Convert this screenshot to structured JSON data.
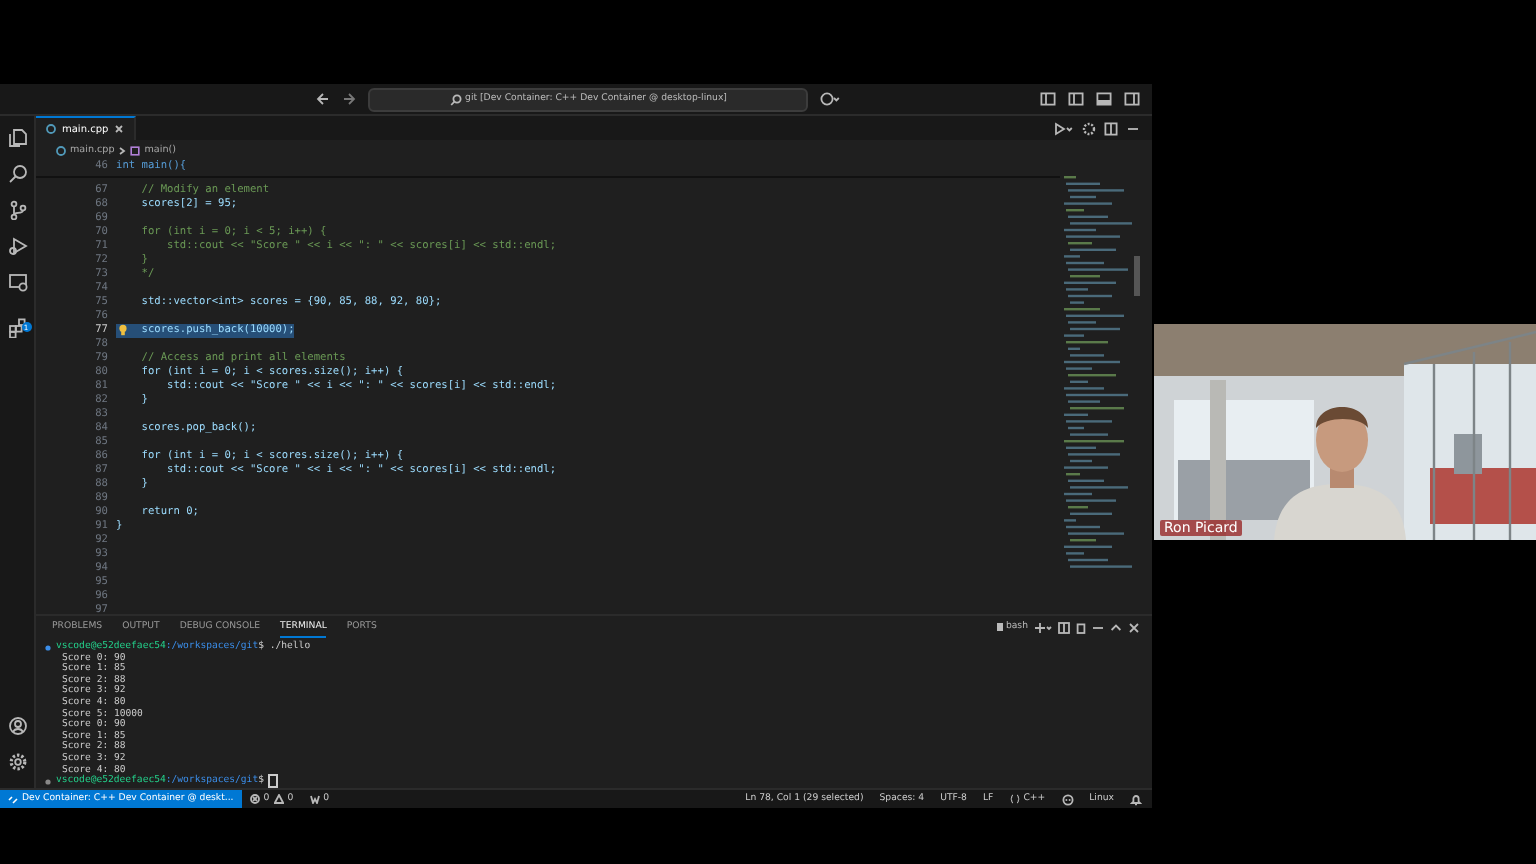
{
  "title_bar": {
    "command_center": "git [Dev Container: C++ Dev Container @ desktop-linux]"
  },
  "activity_bar": {
    "extensions_badge": "1"
  },
  "editor": {
    "tabs": [
      {
        "label": "main.cpp",
        "selected": true
      }
    ],
    "breadcrumbs": [
      "main.cpp",
      "main()"
    ],
    "sticky_line": {
      "number": "46",
      "text": "int main(){"
    },
    "lines": [
      {
        "number": "67",
        "kind": "comment",
        "text": "    // Modify an element",
        "selected": false,
        "lightbulb": false
      },
      {
        "number": "68",
        "kind": "code",
        "text": "    scores[2] = 95;",
        "selected": false,
        "lightbulb": false
      },
      {
        "number": "69",
        "selected": false,
        "lightbulb": false
      },
      {
        "number": "70",
        "kind": "comment",
        "text": "    for (int i = 0; i < 5; i++) {",
        "selected": false,
        "lightbulb": false
      },
      {
        "number": "71",
        "kind": "comment",
        "text": "        std::cout << \"Score \" << i << \": \" << scores[i] << std::endl;",
        "selected": false,
        "lightbulb": false
      },
      {
        "number": "72",
        "kind": "comment",
        "text": "    }",
        "selected": false,
        "lightbulb": false
      },
      {
        "number": "73",
        "kind": "comment",
        "text": "    */",
        "selected": false,
        "lightbulb": false
      },
      {
        "number": "74",
        "selected": false,
        "lightbulb": false
      },
      {
        "number": "75",
        "kind": "code",
        "text": "    std::vector<int> scores = {90, 85, 88, 92, 80};",
        "selected": false,
        "lightbulb": false
      },
      {
        "number": "76",
        "selected": false,
        "lightbulb": false
      },
      {
        "number": "77",
        "kind": "code",
        "text": "    scores.push_back(10000);",
        "selected": true,
        "lightbulb": true
      },
      {
        "number": "78",
        "selected": false,
        "lightbulb": false
      },
      {
        "number": "79",
        "kind": "comment",
        "text": "    // Access and print all elements",
        "selected": false,
        "lightbulb": false
      },
      {
        "number": "80",
        "kind": "code",
        "text": "    for (int i = 0; i < scores.size(); i++) {",
        "selected": false,
        "lightbulb": false
      },
      {
        "number": "81",
        "kind": "code",
        "text": "        std::cout << \"Score \" << i << \": \" << scores[i] << std::endl;",
        "selected": false,
        "lightbulb": false
      },
      {
        "number": "82",
        "kind": "code",
        "text": "    }",
        "selected": false,
        "lightbulb": false
      },
      {
        "number": "83",
        "selected": false,
        "lightbulb": false
      },
      {
        "number": "84",
        "kind": "code",
        "text": "    scores.pop_back();",
        "selected": false,
        "lightbulb": false
      },
      {
        "number": "85",
        "selected": false,
        "lightbulb": false
      },
      {
        "number": "86",
        "kind": "code",
        "text": "    for (int i = 0; i < scores.size(); i++) {",
        "selected": false,
        "lightbulb": false
      },
      {
        "number": "87",
        "kind": "code",
        "text": "        std::cout << \"Score \" << i << \": \" << scores[i] << std::endl;",
        "selected": false,
        "lightbulb": false
      },
      {
        "number": "88",
        "kind": "code",
        "text": "    }",
        "selected": false,
        "lightbulb": false
      },
      {
        "number": "89",
        "selected": false,
        "lightbulb": false
      },
      {
        "number": "90",
        "kind": "code",
        "text": "    return 0;",
        "selected": false,
        "lightbulb": false
      },
      {
        "number": "91",
        "kind": "code",
        "text": "}",
        "selected": false,
        "lightbulb": false
      },
      {
        "number": "92",
        "selected": false,
        "lightbulb": false
      },
      {
        "number": "93",
        "selected": false,
        "lightbulb": false
      },
      {
        "number": "94",
        "selected": false,
        "lightbulb": false
      },
      {
        "number": "95",
        "selected": false,
        "lightbulb": false
      },
      {
        "number": "96",
        "selected": false,
        "lightbulb": false
      },
      {
        "number": "97",
        "selected": false,
        "lightbulb": false
      }
    ]
  },
  "panel": {
    "tabs": [
      {
        "label": "PROBLEMS",
        "selected": false
      },
      {
        "label": "OUTPUT",
        "selected": false
      },
      {
        "label": "DEBUG CONSOLE",
        "selected": false
      },
      {
        "label": "TERMINAL",
        "selected": true
      },
      {
        "label": "PORTS",
        "selected": false
      }
    ],
    "terminal_name": "bash",
    "terminal_lines": [
      {
        "kind": "prompt",
        "user": "vscode@e52deefaec54",
        "path": ":/workspaces/git",
        "symbol": "$",
        "command": "./hello"
      },
      {
        "kind": "output",
        "text": "Score 0: 90"
      },
      {
        "kind": "output",
        "text": "Score 1: 85"
      },
      {
        "kind": "output",
        "text": "Score 2: 88"
      },
      {
        "kind": "output",
        "text": "Score 3: 92"
      },
      {
        "kind": "output",
        "text": "Score 4: 80"
      },
      {
        "kind": "output",
        "text": "Score 5: 10000"
      },
      {
        "kind": "output",
        "text": "Score 0: 90"
      },
      {
        "kind": "output",
        "text": "Score 1: 85"
      },
      {
        "kind": "output",
        "text": "Score 2: 88"
      },
      {
        "kind": "output",
        "text": "Score 3: 92"
      },
      {
        "kind": "output",
        "text": "Score 4: 80"
      },
      {
        "kind": "prompt",
        "user": "vscode@e52deefaec54",
        "path": ":/workspaces/git",
        "symbol": "$"
      }
    ]
  },
  "status_bar": {
    "remote": "Dev Container: C++ Dev Container @ deskt...",
    "errors": "0",
    "warnings": "0",
    "ports": "0",
    "right": [
      {
        "kind": "text",
        "text": "Ln 78, Col 1 (29 selected)"
      },
      {
        "kind": "text",
        "text": "Spaces: 4"
      },
      {
        "kind": "text",
        "text": "UTF-8"
      },
      {
        "kind": "text",
        "text": "LF"
      },
      {
        "kind": "language",
        "text": "C++"
      },
      {
        "kind": "copilot"
      },
      {
        "kind": "text",
        "text": "Linux"
      },
      {
        "kind": "bell"
      }
    ]
  },
  "video": {
    "kind": "picture",
    "name": "Ron Picard"
  }
}
